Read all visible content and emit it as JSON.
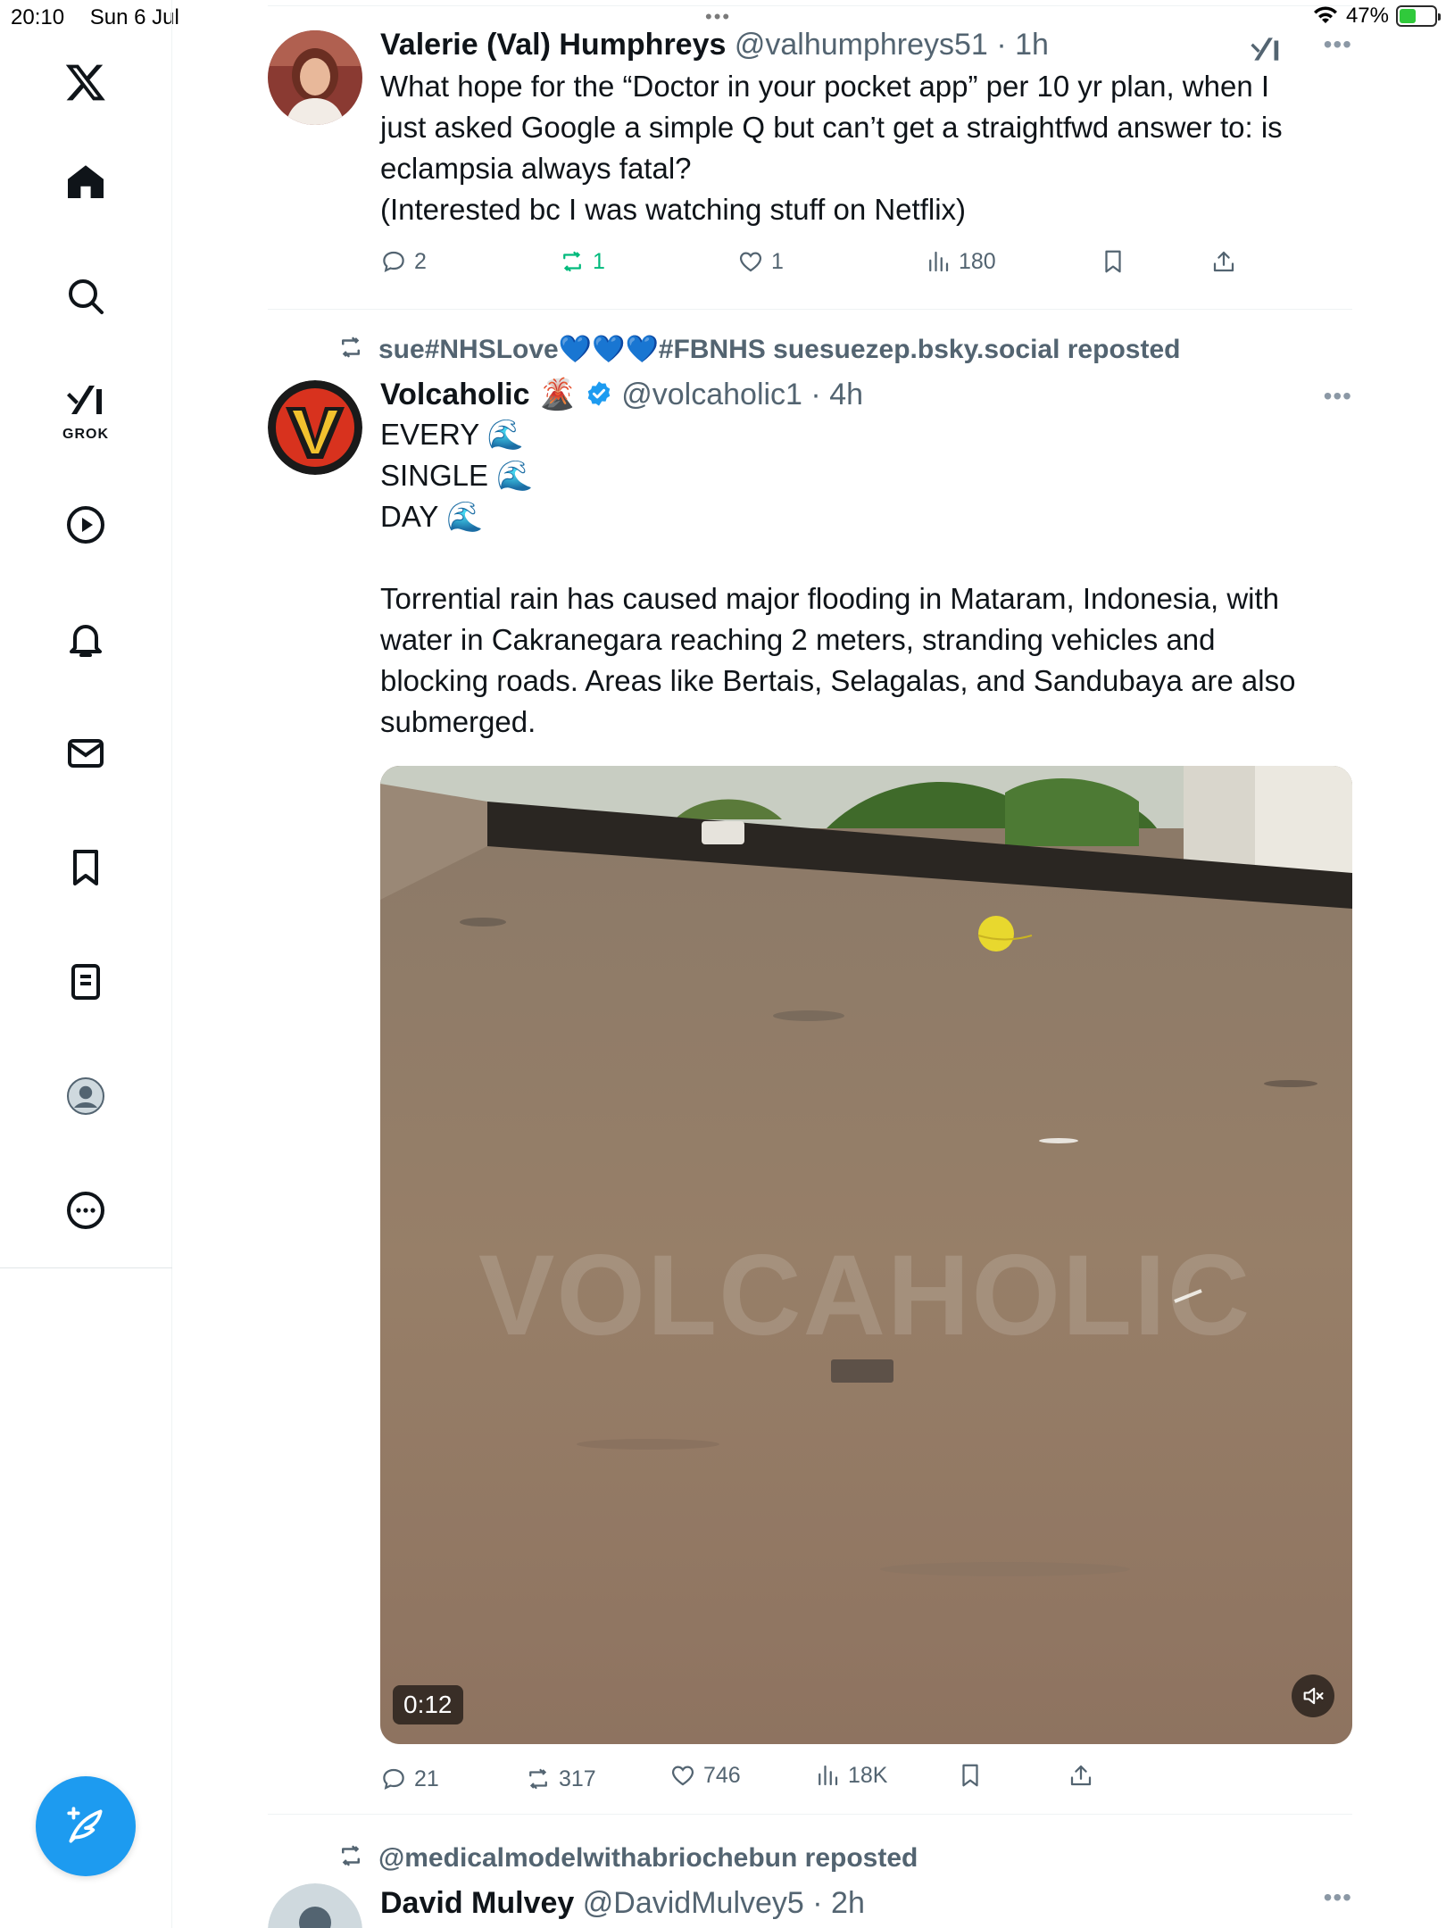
{
  "status_bar": {
    "time": "20:10",
    "date": "Sun 6 Jul",
    "battery": "47%",
    "battery_level": 0.47
  },
  "sidebar": {
    "logo": "x-logo-icon",
    "items": [
      {
        "label": "Home",
        "icon": "home-icon"
      },
      {
        "label": "Explore",
        "icon": "search-icon"
      },
      {
        "label": "Grok",
        "icon": "grok-icon",
        "caption": "GROK"
      },
      {
        "label": "Video",
        "icon": "play-icon"
      },
      {
        "label": "Notifications",
        "icon": "bell-icon"
      },
      {
        "label": "Messages",
        "icon": "mail-icon"
      },
      {
        "label": "Bookmarks",
        "icon": "bookmark-icon"
      },
      {
        "label": "Lists",
        "icon": "list-icon"
      },
      {
        "label": "Profile",
        "icon": "avatar-icon"
      },
      {
        "label": "More",
        "icon": "more-icon"
      }
    ],
    "compose_icon": "compose-icon"
  },
  "tweets": [
    {
      "name": "Valerie (Val) Humphreys",
      "handle": "@valhumphreys51",
      "time": "· 1h",
      "text": "What hope for the “Doctor in your pocket app” per 10 yr plan, when I\njust asked Google a simple Q but can’t get a straightfwd answer to: is\neclampsia always fatal?\n(Interested bc I was watching stuff on Netflix)",
      "replies": "2",
      "reposts": "1",
      "likes": "1",
      "views": "180"
    },
    {
      "repost_by": "sue#NHSLove💙💙💙#FBNHS suesuezep.bsky.social reposted",
      "name": "Volcaholic",
      "name_emoji": "🌋",
      "handle": "@volcaholic1",
      "time": "· 4h",
      "text": "EVERY 🌊\nSINGLE 🌊\nDAY 🌊\n\nTorrential rain has caused major flooding in Mataram, Indonesia, with\nwater in Cakranegara reaching 2 meters, stranding vehicles and\nblocking roads. Areas like Bertais, Selagalas, and Sandubaya are also\nsubmerged.",
      "video_duration": "0:12",
      "video_watermark": "VOLCAHOLIC",
      "replies": "21",
      "reposts": "317",
      "likes": "746",
      "views": "18K"
    },
    {
      "repost_by": "@medicalmodelwithabriochebun reposted",
      "name": "David Mulvey",
      "handle": "@DavidMulvey5",
      "time": "· 2h"
    }
  ]
}
